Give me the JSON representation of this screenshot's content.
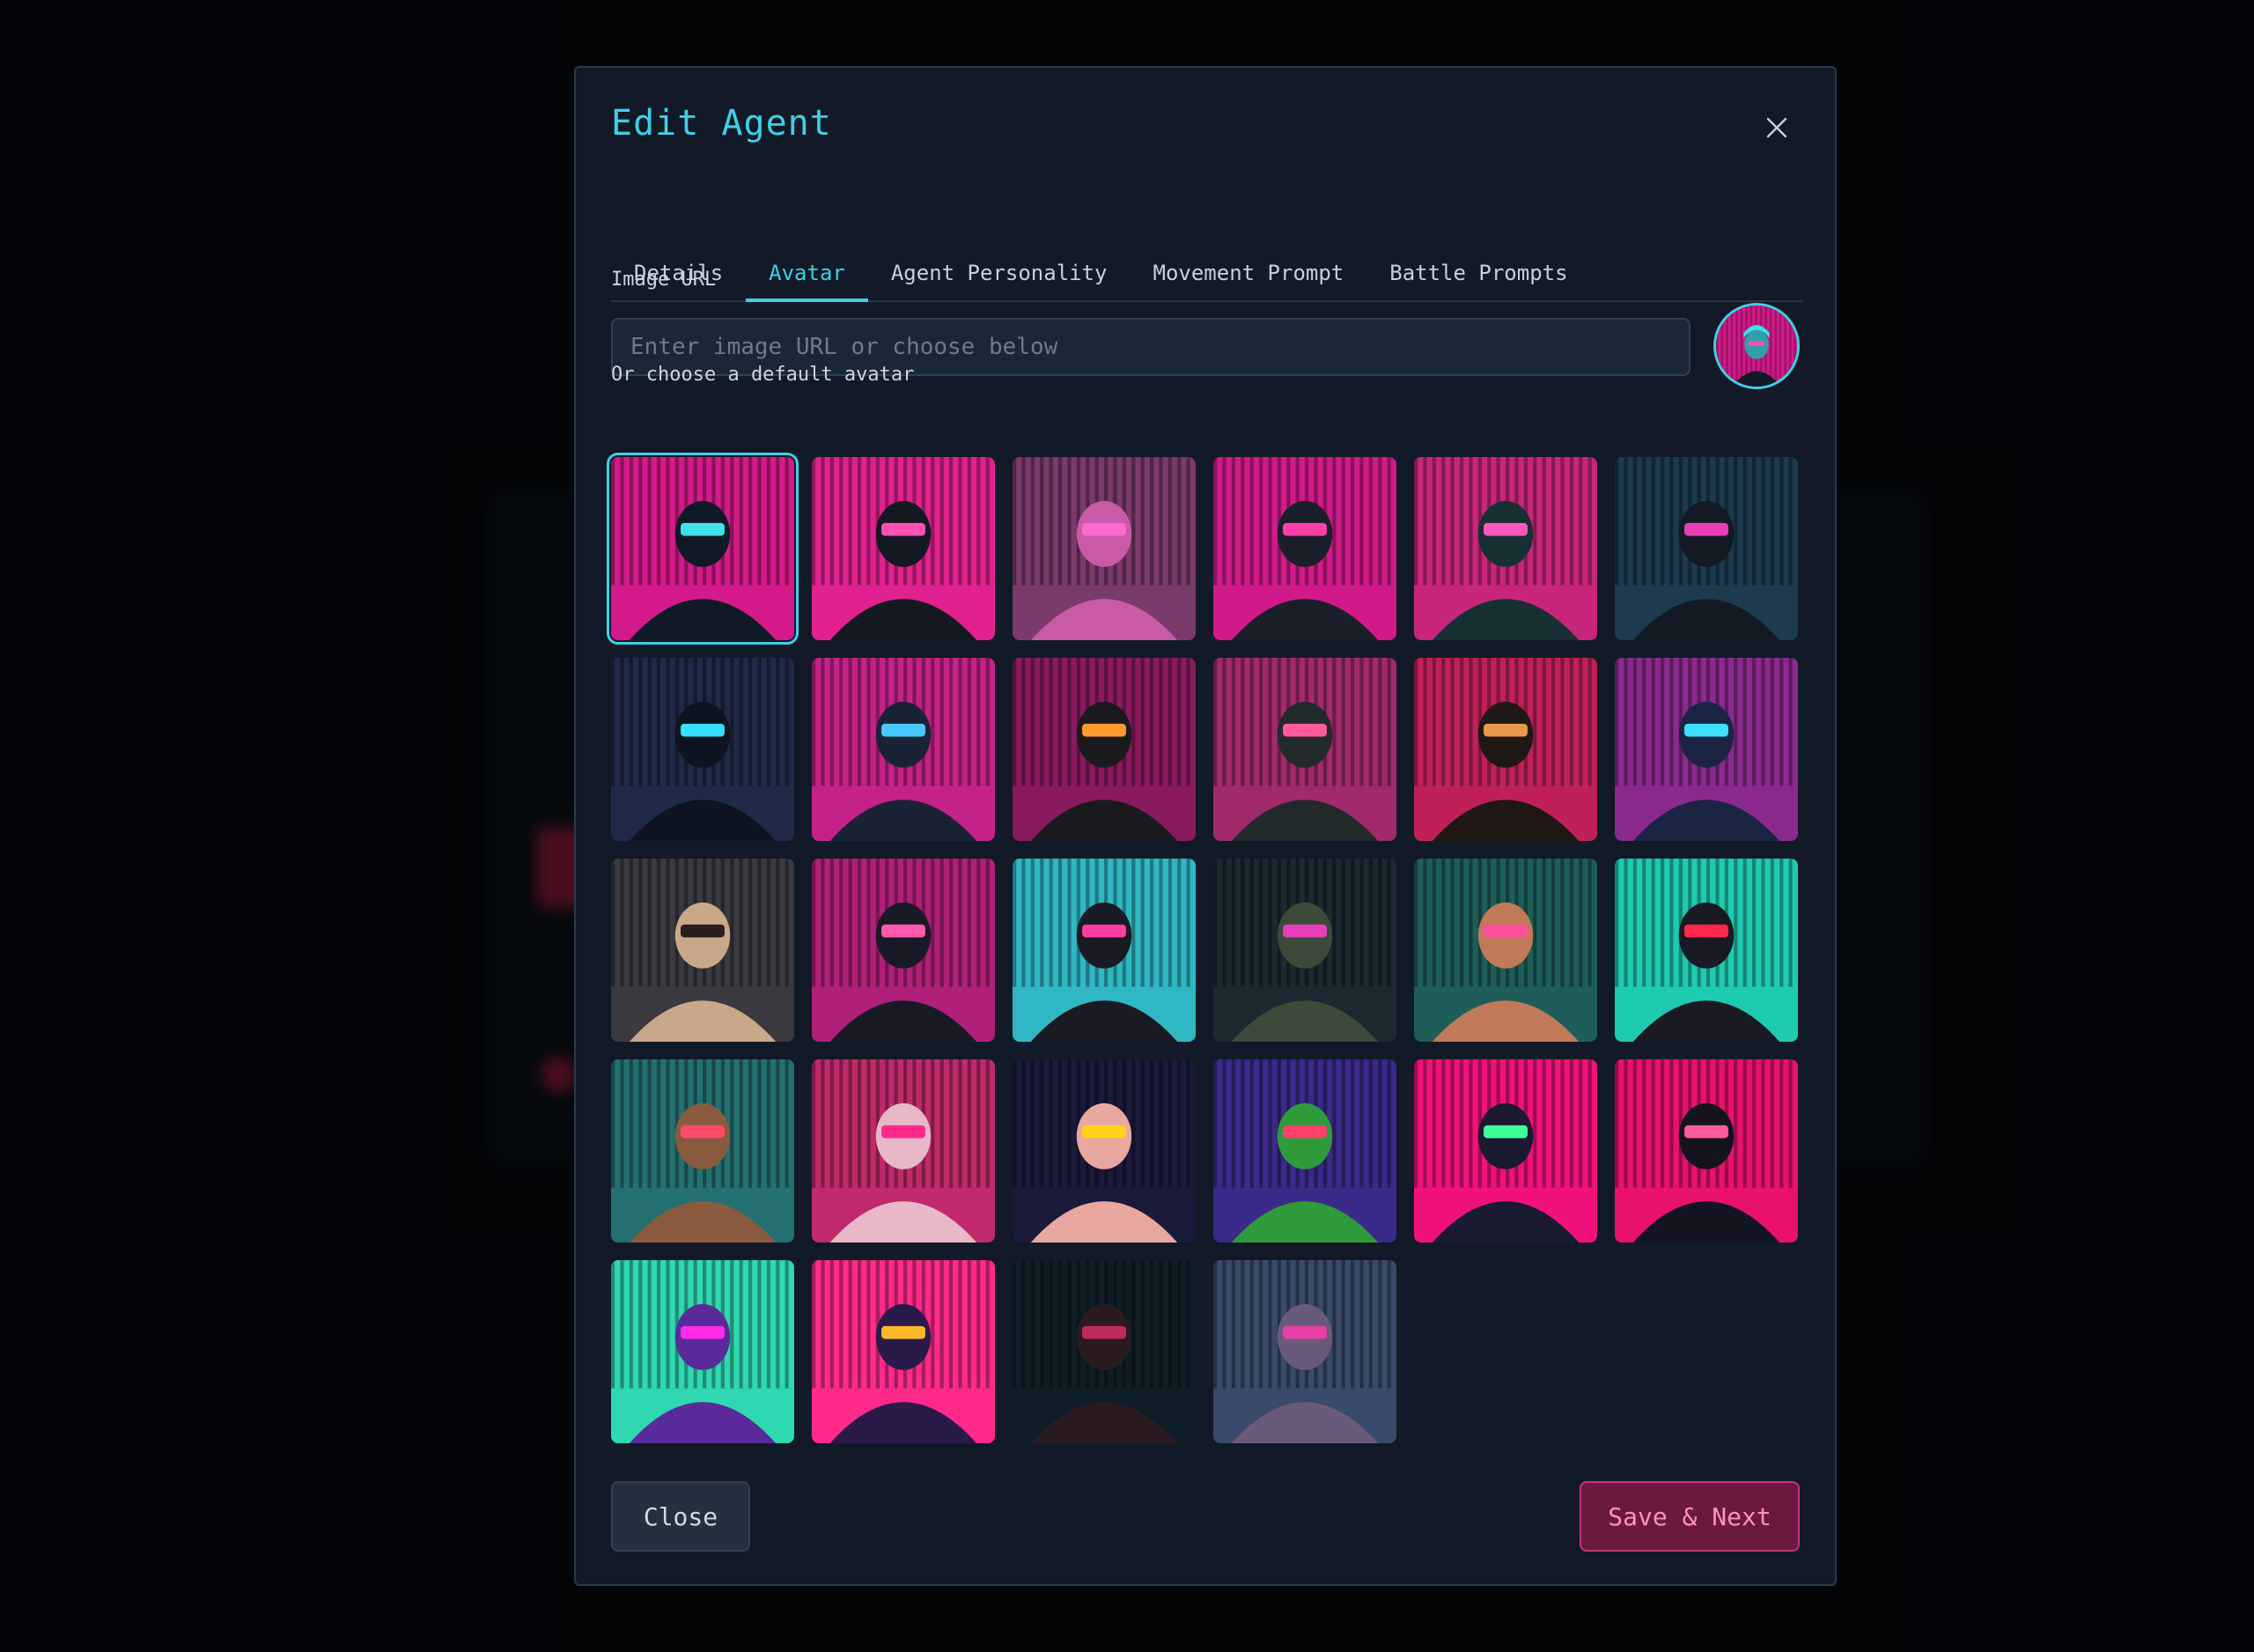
{
  "modal": {
    "title": "Edit Agent",
    "close_icon": "close-icon"
  },
  "tabs": [
    {
      "label": "Details",
      "active": false
    },
    {
      "label": "Avatar",
      "active": true
    },
    {
      "label": "Agent Personality",
      "active": false
    },
    {
      "label": "Movement Prompt",
      "active": false
    },
    {
      "label": "Battle Prompts",
      "active": false
    }
  ],
  "image_url": {
    "label": "Image URL",
    "placeholder": "Enter image URL or choose below",
    "value": ""
  },
  "default_avatar": {
    "label": "Or choose a default avatar",
    "selected_index": 0
  },
  "avatars": [
    {
      "name": "cyber-woman-pink-visor",
      "bg": "#d41a8a",
      "fg": "#0f1a26",
      "accent": "#3fe0ea"
    },
    {
      "name": "robot-tv-head-soldier",
      "bg": "#e0218f",
      "fg": "#141820",
      "accent": "#ff4fb0"
    },
    {
      "name": "cyber-girl-cat-ears",
      "bg": "#7a3a6a",
      "fg": "#c95aa8",
      "accent": "#ff6ad0"
    },
    {
      "name": "bearded-man-goggles",
      "bg": "#d01a8a",
      "fg": "#1a1f2a",
      "accent": "#ff3fa8"
    },
    {
      "name": "hacker-pink-glasses",
      "bg": "#c7267a",
      "fg": "#173033",
      "accent": "#ff56c0"
    },
    {
      "name": "cyber-bear",
      "bg": "#1d3a4e",
      "fg": "#141a24",
      "accent": "#e83fb8"
    },
    {
      "name": "black-cat-agent",
      "bg": "#1e2a48",
      "fg": "#0e1420",
      "accent": "#35e0ff"
    },
    {
      "name": "dog-robot-visor",
      "bg": "#c52288",
      "fg": "#1a2236",
      "accent": "#47c9ff"
    },
    {
      "name": "ape-commander",
      "bg": "#8a1a5e",
      "fg": "#1b1a1e",
      "accent": "#ff9a2e"
    },
    {
      "name": "bird-soldier",
      "bg": "#a12a6a",
      "fg": "#232a2c",
      "accent": "#ff5a9c"
    },
    {
      "name": "lion-warrior",
      "bg": "#c0205a",
      "fg": "#1f1814",
      "accent": "#e89a4a"
    },
    {
      "name": "elephant-mech",
      "bg": "#8a2a8e",
      "fg": "#1c2444",
      "accent": "#3fe0ff"
    },
    {
      "name": "alien-grey",
      "bg": "#3a3a40",
      "fg": "#c9a88a",
      "accent": "#2a1e1e"
    },
    {
      "name": "penguin-rider",
      "bg": "#b0207a",
      "fg": "#1a1a26",
      "accent": "#ff5ab0"
    },
    {
      "name": "hat-man-teal",
      "bg": "#2fb8c4",
      "fg": "#1a1a22",
      "accent": "#ff3fa0"
    },
    {
      "name": "frog-mech",
      "bg": "#1a2a30",
      "fg": "#3c4a3a",
      "accent": "#e83fb8"
    },
    {
      "name": "teal-woman",
      "bg": "#1f5e58",
      "fg": "#c07a5a",
      "accent": "#ff4f9a"
    },
    {
      "name": "red-visor-man",
      "bg": "#1fcbb0",
      "fg": "#1a1a24",
      "accent": "#ff2a4a"
    },
    {
      "name": "punk-woman",
      "bg": "#247070",
      "fg": "#8a5a3e",
      "accent": "#ff4a6a"
    },
    {
      "name": "pink-goggles-girl",
      "bg": "#c02a6a",
      "fg": "#e8b8c8",
      "accent": "#ff2a8a"
    },
    {
      "name": "yellow-goggles-girl",
      "bg": "#1a1a3a",
      "fg": "#e8a8a0",
      "accent": "#ffd21a"
    },
    {
      "name": "psychedelic-swirl",
      "bg": "#3a2a8a",
      "fg": "#2f9a3a",
      "accent": "#ff3f6a"
    },
    {
      "name": "magenta-silhouette",
      "bg": "#f0127a",
      "fg": "#1a1a30",
      "accent": "#3fff9a"
    },
    {
      "name": "glitch-silhouette",
      "bg": "#e8126a",
      "fg": "#141420",
      "accent": "#ff5a9a"
    },
    {
      "name": "mint-helmet-figure",
      "bg": "#2fd8b0",
      "fg": "#5a2a9a",
      "accent": "#ff2ae8"
    },
    {
      "name": "striped-helmet-figure",
      "bg": "#ff2a8a",
      "fg": "#2a1a4a",
      "accent": "#ffb82a"
    },
    {
      "name": "bearded-hat-elder",
      "bg": "#0f1e26",
      "fg": "#2a1a22",
      "accent": "#c02a5a"
    },
    {
      "name": "old-warrior",
      "bg": "#3a4a6a",
      "fg": "#6a5a7a",
      "accent": "#e83fa8"
    }
  ],
  "buttons": {
    "close_label": "Close",
    "save_label": "Save & Next"
  },
  "colors": {
    "accent": "#3fd0e6",
    "primary_button": "#6a1a3f",
    "modal_bg": "#111a26"
  }
}
